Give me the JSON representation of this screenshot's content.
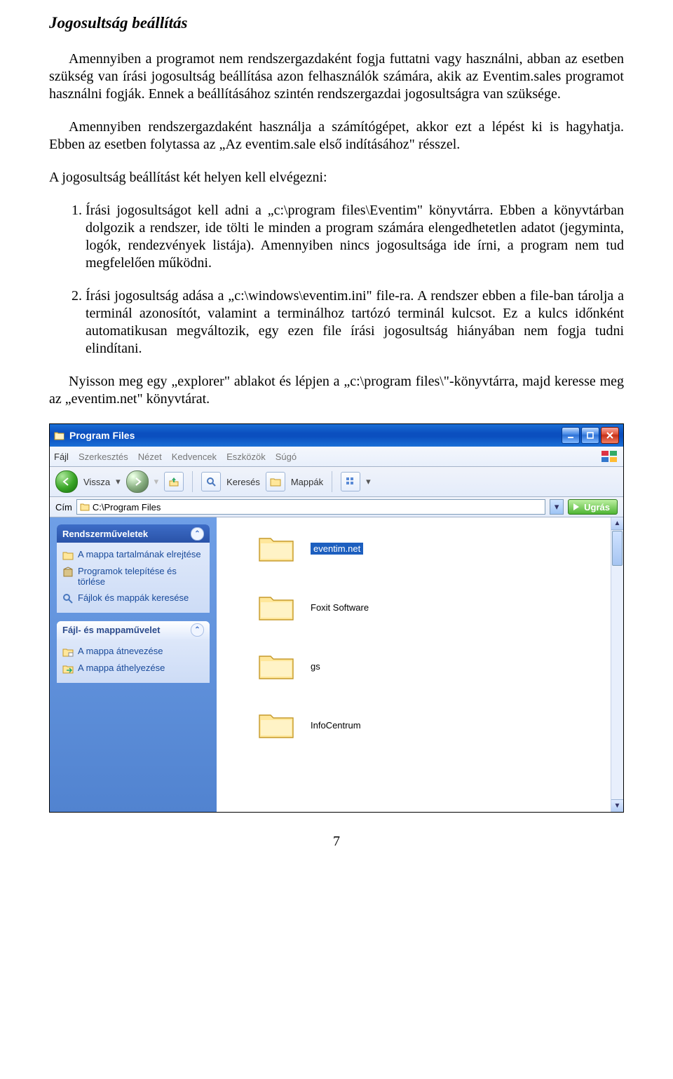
{
  "doc": {
    "title": "Jogosultság beállítás",
    "p1": "Amennyiben a programot nem rendszergazdaként fogja futtatni vagy használni, abban az esetben szükség van írási jogosultság beállítása azon felhasználók számára, akik az Eventim.sales programot használni fogják. Ennek a beállításához szintén rendszergazdai jogosultságra van szüksége.",
    "p2": "Amennyiben rendszergazdaként használja a számítógépet, akkor ezt a lépést ki is hagyhatja. Ebben az esetben folytassa az „Az eventim.sale első indításához\" résszel.",
    "p3": "A jogosultság beállítást két helyen kell elvégezni:",
    "li1": "Írási jogosultságot kell adni a „c:\\program files\\Eventim\" könyvtárra. Ebben a könyvtárban dolgozik a rendszer, ide tölti le minden a program számára elengedhetetlen adatot (jegyminta, logók, rendezvények listája). Amennyiben nincs jogosultsága ide írni, a program nem tud megfelelően működni.",
    "li2": "Írási jogosultság adása a „c:\\windows\\eventim.ini\" file-ra. A rendszer ebben a file-ban tárolja a terminál azonosítót, valamint a terminálhoz tartózó terminál kulcsot. Ez a kulcs időnként automatikusan megváltozik, egy ezen file írási jogosultság hiányában nem fogja tudni elindítani.",
    "p4": "Nyisson meg egy „explorer\" ablakot és lépjen a „c:\\program files\\\"-könyvtárra, majd keresse meg az „eventim.net\" könyvtárat.",
    "page_num": "7"
  },
  "explorer": {
    "title": "Program Files",
    "menu": [
      "Fájl",
      "Szerkesztés",
      "Nézet",
      "Kedvencek",
      "Eszközök",
      "Súgó"
    ],
    "toolbar": {
      "back": "Vissza",
      "search": "Keresés",
      "folders": "Mappák"
    },
    "address": {
      "label": "Cím",
      "path": "C:\\Program Files",
      "go": "Ugrás"
    },
    "panel1": {
      "header": "Rendszerműveletek",
      "tasks": [
        "A mappa tartalmának elrejtése",
        "Programok telepítése és törlése",
        "Fájlok és mappák keresése"
      ]
    },
    "panel2": {
      "header": "Fájl- és mappaművelet",
      "tasks": [
        "A mappa átnevezése",
        "A mappa áthelyezése"
      ]
    },
    "folders": [
      "eventim.net",
      "Foxit Software",
      "gs",
      "InfoCentrum"
    ]
  }
}
